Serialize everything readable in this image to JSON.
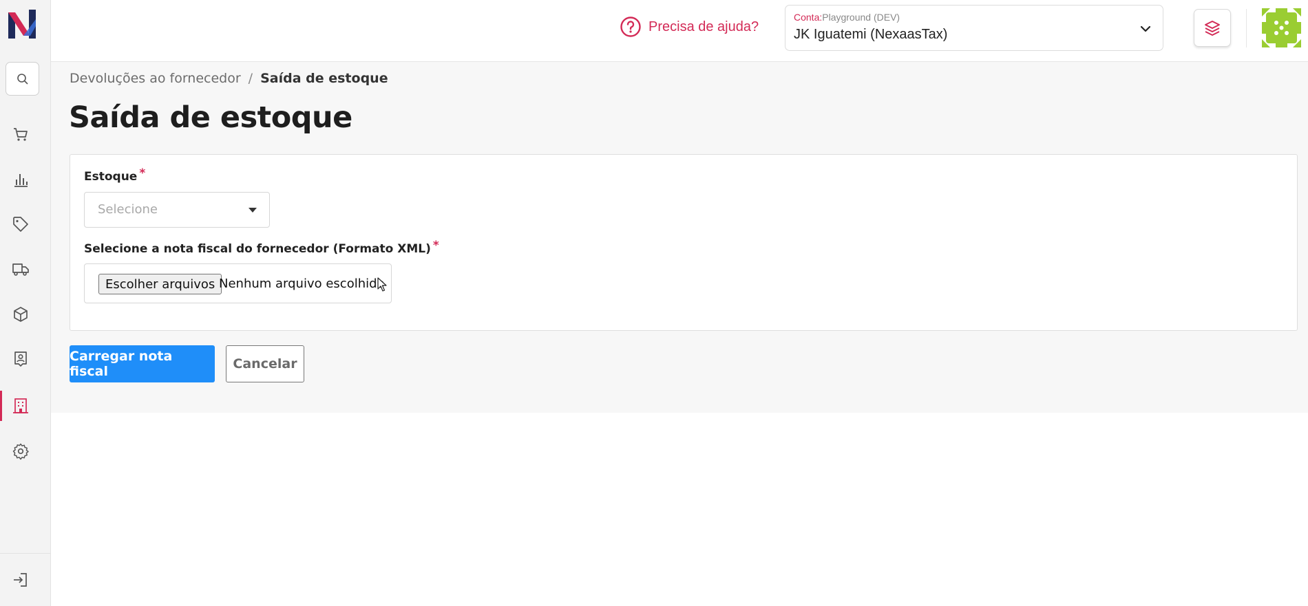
{
  "header": {
    "help_text": "Precisa de ajuda?",
    "account_caption_key": "Conta:",
    "account_caption_value": "Playground (DEV)",
    "account_value": "JK Iguatemi (NexaasTax)"
  },
  "sidebar": {
    "items": [
      {
        "icon": "cart-icon"
      },
      {
        "icon": "bar-chart-icon"
      },
      {
        "icon": "tag-icon"
      },
      {
        "icon": "truck-icon"
      },
      {
        "icon": "box-icon"
      },
      {
        "icon": "contact-icon"
      },
      {
        "icon": "building-icon",
        "active": true
      },
      {
        "icon": "gear-icon"
      }
    ],
    "bottom_icon": "logout-icon"
  },
  "breadcrumb": {
    "parent": "Devoluções ao fornecedor",
    "separator": "/",
    "current": "Saída de estoque"
  },
  "page": {
    "title": "Saída de estoque"
  },
  "form": {
    "stock_label": "Estoque",
    "stock_required": "*",
    "stock_placeholder": "Selecione",
    "file_label": "Selecione a nota fiscal do fornecedor (Formato XML)",
    "file_required": "*",
    "file_button": "Escolher arquivos",
    "file_status": "Nenhum arquivo escolhido"
  },
  "actions": {
    "submit": "Carregar nota fiscal",
    "cancel": "Cancelar"
  },
  "colors": {
    "accent": "#d32a56",
    "primary": "#1f8ef9",
    "avatar": "#9acd32"
  }
}
